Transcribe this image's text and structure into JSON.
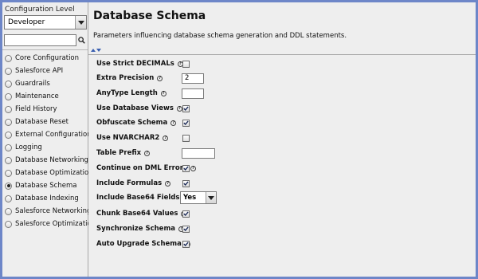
{
  "sidebar": {
    "config_level_label": "Configuration Level",
    "config_level_value": "Developer",
    "search_value": "",
    "items": [
      {
        "label": "Core Configuration",
        "selected": false
      },
      {
        "label": "Salesforce API",
        "selected": false
      },
      {
        "label": "Guardrails",
        "selected": false
      },
      {
        "label": "Maintenance",
        "selected": false
      },
      {
        "label": "Field History",
        "selected": false
      },
      {
        "label": "Database Reset",
        "selected": false
      },
      {
        "label": "External Configuration",
        "selected": false
      },
      {
        "label": "Logging",
        "selected": false
      },
      {
        "label": "Database Networking",
        "selected": false
      },
      {
        "label": "Database Optimization",
        "selected": false
      },
      {
        "label": "Database Schema",
        "selected": true
      },
      {
        "label": "Database Indexing",
        "selected": false
      },
      {
        "label": "Salesforce Networking",
        "selected": false
      },
      {
        "label": "Salesforce Optimization",
        "selected": false
      }
    ]
  },
  "main": {
    "title": "Database Schema",
    "description": "Parameters influencing database schema generation and DDL statements.",
    "settings": [
      {
        "label": "Use Strict DECIMALs",
        "type": "checkbox",
        "checked": false
      },
      {
        "label": "Extra Precision",
        "type": "text",
        "value": "2"
      },
      {
        "label": "AnyType Length",
        "type": "text",
        "value": ""
      },
      {
        "label": "Use Database Views",
        "type": "checkbox",
        "checked": true
      },
      {
        "label": "Obfuscate Schema",
        "type": "checkbox",
        "checked": true
      },
      {
        "label": "Use NVARCHAR2",
        "type": "checkbox",
        "checked": false
      },
      {
        "label": "Table Prefix",
        "type": "text",
        "value": ""
      },
      {
        "label": "Continue on DML Errors",
        "type": "checkbox",
        "checked": true
      },
      {
        "label": "Include Formulas",
        "type": "checkbox",
        "checked": true
      },
      {
        "label": "Include Base64 Fields",
        "type": "select",
        "value": "Yes"
      },
      {
        "label": "Chunk Base64 Values",
        "type": "checkbox",
        "checked": true
      },
      {
        "label": "Synchronize Schema",
        "type": "checkbox",
        "checked": true
      },
      {
        "label": "Auto Upgrade Schema",
        "type": "checkbox",
        "checked": true
      }
    ]
  },
  "icons": {
    "help": "help-icon",
    "search": "search-icon",
    "check": "check-icon"
  },
  "colors": {
    "frame_border": "#6d86c8",
    "splitter_arrow": "#3a5fb0",
    "panel_bg": "#eeeeee"
  }
}
